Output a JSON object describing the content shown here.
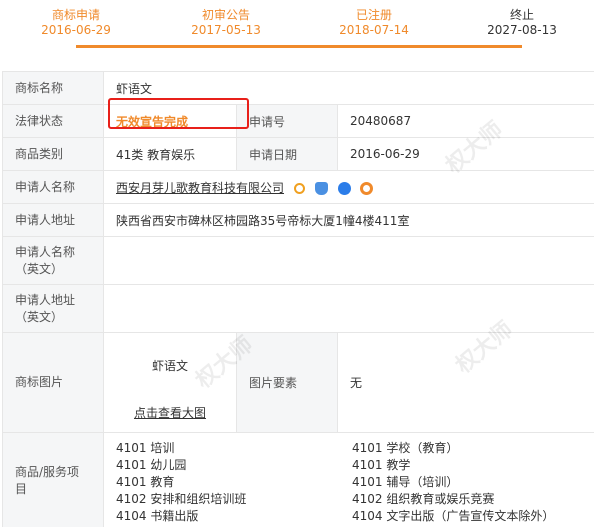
{
  "timeline": [
    {
      "title": "商标申请",
      "date": "2016-06-29"
    },
    {
      "title": "初审公告",
      "date": "2017-05-13"
    },
    {
      "title": "已注册",
      "date": "2018-07-14"
    },
    {
      "title": "终止",
      "date": "2027-08-13"
    }
  ],
  "fields": {
    "trademark_name_label": "商标名称",
    "trademark_name": "虾语文",
    "legal_status_label": "法律状态",
    "legal_status": "无效宣告完成",
    "application_no_label": "申请号",
    "application_no": "20480687",
    "category_label": "商品类别",
    "category": "41类 教育娱乐",
    "application_date_label": "申请日期",
    "application_date": "2016-06-29",
    "applicant_name_label": "申请人名称",
    "applicant_name": "西安月芽儿歌教育科技有限公司",
    "applicant_address_label": "申请人地址",
    "applicant_address": "陕西省西安市碑林区柿园路35号帝标大厦1幢4楼411室",
    "applicant_name_en_label": "申请人名称（英文）",
    "applicant_address_en_label": "申请人地址（英文）",
    "trademark_image_label": "商标图片",
    "trademark_image_text": "虾语文",
    "view_large_link": "点击查看大图",
    "image_elements_label": "图片要素",
    "image_elements": "无",
    "goods_services_label": "商品/服务项目"
  },
  "goods": [
    "4101 培训",
    "4101 学校（教育）",
    "4101 幼儿园",
    "4101 教学",
    "4101 教育",
    "4101 辅导（培训）",
    "4102 安排和组织培训班",
    "4102 组织教育或娱乐竞赛",
    "4104 书籍出版",
    "4104 文字出版（广告宣传文本除外）"
  ],
  "watermark": "权大师",
  "colors": {
    "accent": "#f08a2b",
    "highlight_box": "#e8201a"
  }
}
